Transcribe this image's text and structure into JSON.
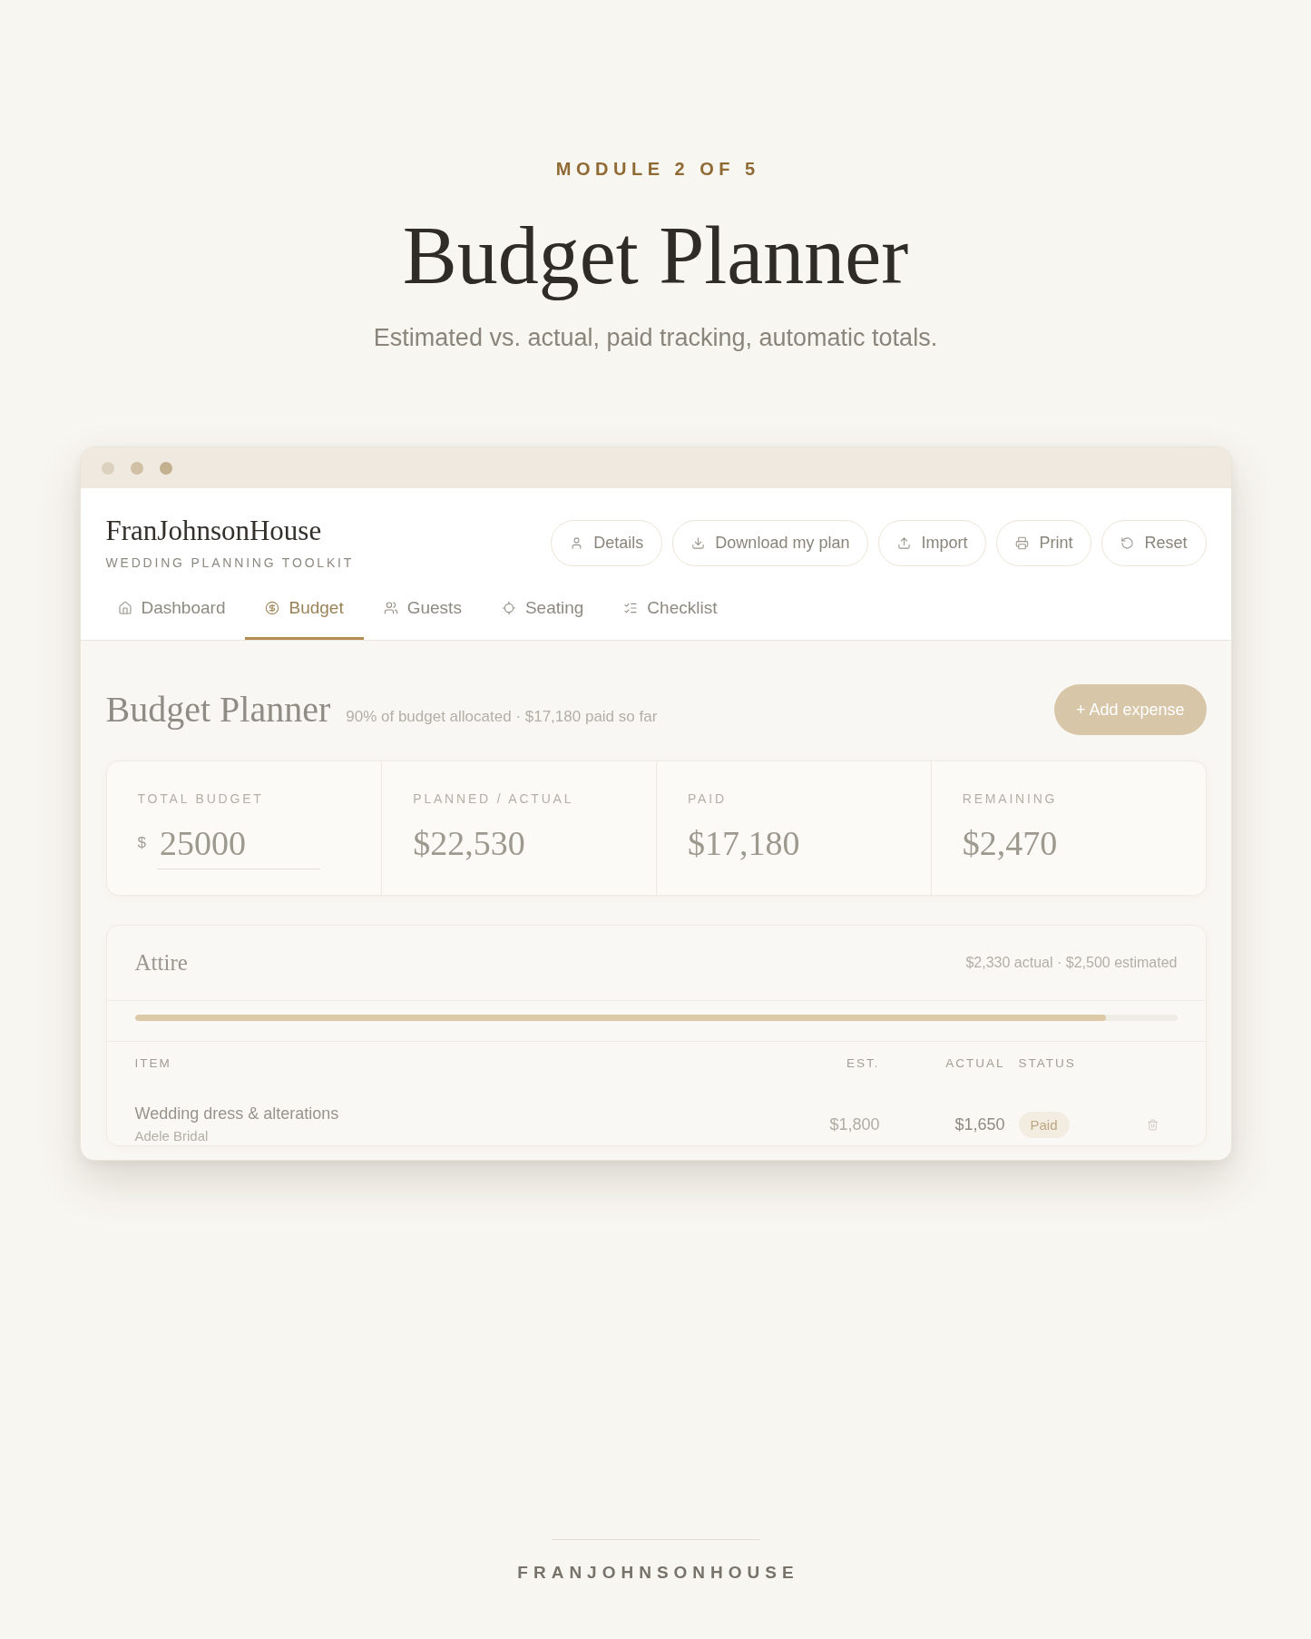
{
  "hero": {
    "eyebrow": "MODULE 2 OF 5",
    "title": "Budget Planner",
    "subtitle": "Estimated vs. actual, paid tracking, automatic totals."
  },
  "window": {
    "brand": {
      "name": "FranJohnsonHouse",
      "tagline": "WEDDING PLANNING TOOLKIT"
    },
    "actions": [
      {
        "kind": "details",
        "label": "Details"
      },
      {
        "kind": "download",
        "label": "Download my plan"
      },
      {
        "kind": "import",
        "label": "Import"
      },
      {
        "kind": "print",
        "label": "Print"
      },
      {
        "kind": "reset",
        "label": "Reset"
      }
    ],
    "tabs": [
      {
        "kind": "dashboard",
        "label": "Dashboard",
        "selected": false
      },
      {
        "kind": "budget",
        "label": "Budget",
        "selected": true
      },
      {
        "kind": "guests",
        "label": "Guests",
        "selected": false
      },
      {
        "kind": "seating",
        "label": "Seating",
        "selected": false
      },
      {
        "kind": "checklist",
        "label": "Checklist",
        "selected": false
      }
    ],
    "page": {
      "title": "Budget Planner",
      "summary": "90% of budget allocated · $17,180 paid so far",
      "add_button": "+ Add expense"
    },
    "stats": [
      {
        "kind": "input",
        "label": "TOTAL BUDGET",
        "currency": "$",
        "value": "25000"
      },
      {
        "kind": "figure",
        "label": "PLANNED / ACTUAL",
        "value": "$22,530"
      },
      {
        "kind": "figure",
        "label": "PAID",
        "value": "$17,180"
      },
      {
        "kind": "figure",
        "label": "REMAINING",
        "value": "$2,470"
      }
    ],
    "category": {
      "name": "Attire",
      "summary": "$2,330 actual · $2,500 estimated",
      "level": 0.932,
      "columns": [
        "ITEM",
        "EST.",
        "ACTUAL",
        "STATUS"
      ],
      "rows": [
        {
          "item": "Wedding dress & alterations",
          "vendor": "Adele Bridal",
          "estimated": "$1,800",
          "actual": "$1,650",
          "status": "Paid",
          "paid": true
        }
      ]
    }
  },
  "footer": {
    "brand": "FRANJOHNSONHOUSE"
  }
}
